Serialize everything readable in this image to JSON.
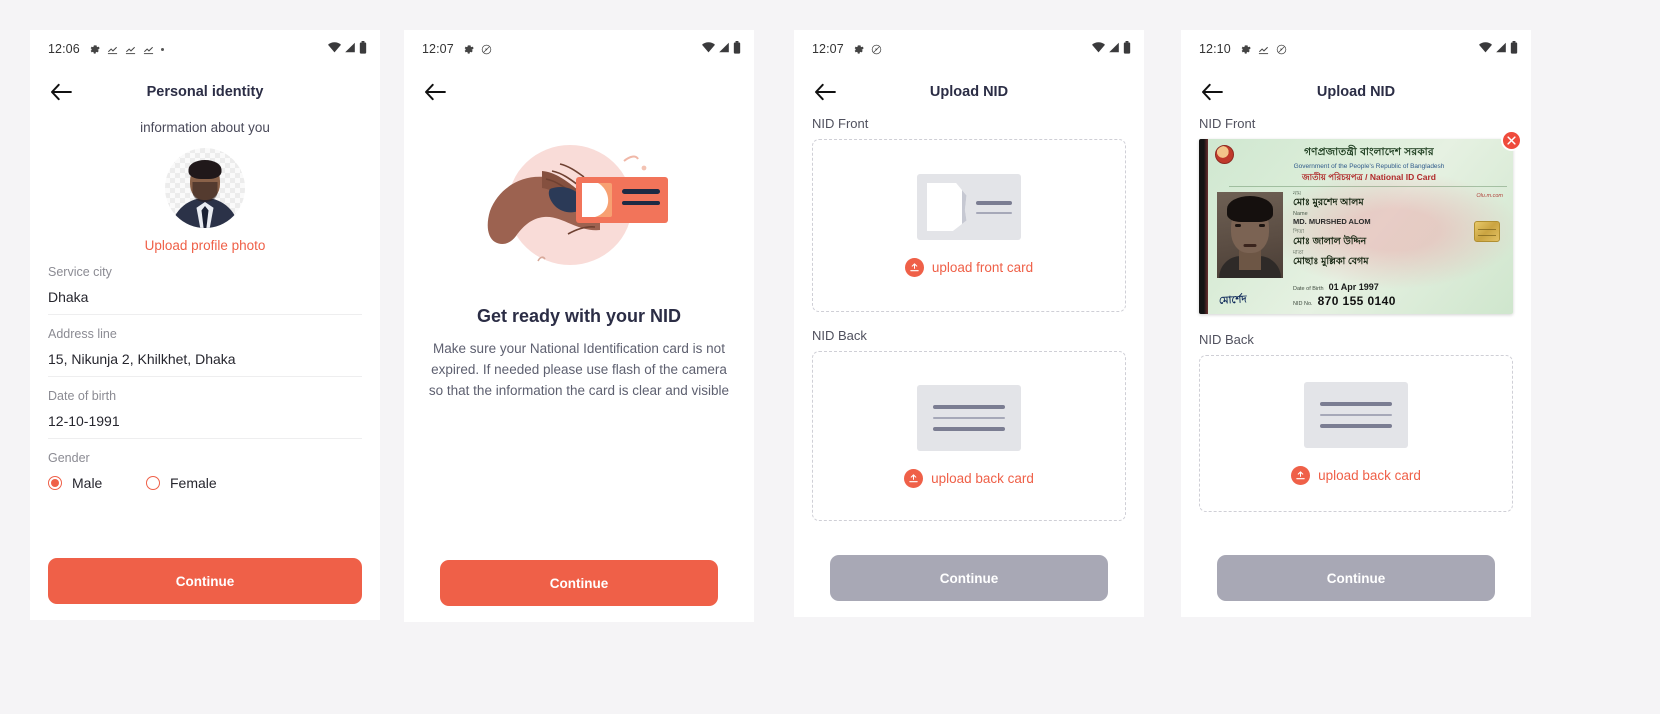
{
  "accent": "#ef6048",
  "disabled_color": "#a8a8b5",
  "title_color": "#2b2d45",
  "screens": {
    "personal_identity": {
      "status": {
        "time": "12:06"
      },
      "appbar": {
        "title": "Personal identity"
      },
      "subtitle": "information about you",
      "upload_photo_label": "Upload profile photo",
      "fields": [
        {
          "label": "Service city",
          "value": "Dhaka"
        },
        {
          "label": "Address line",
          "value": "15, Nikunja 2, Khilkhet, Dhaka"
        },
        {
          "label": "Date of birth",
          "value": "12-10-1991"
        }
      ],
      "gender": {
        "label": "Gender",
        "options": [
          {
            "label": "Male",
            "selected": true
          },
          {
            "label": "Female",
            "selected": false
          }
        ]
      },
      "continue_label": "Continue"
    },
    "get_ready": {
      "status": {
        "time": "12:07"
      },
      "title": "Get ready with your NID",
      "body": "Make sure your National Identification card is not expired. If needed please use flash of the camera so that the information the card is clear and visible",
      "continue_label": "Continue"
    },
    "upload_nid_empty": {
      "status": {
        "time": "12:07"
      },
      "appbar": {
        "title": "Upload NID"
      },
      "front": {
        "label": "NID Front",
        "upload_label": "upload front card"
      },
      "back": {
        "label": "NID Back",
        "upload_label": "upload back card"
      },
      "continue_label": "Continue"
    },
    "upload_nid_filled": {
      "status": {
        "time": "12:10"
      },
      "appbar": {
        "title": "Upload NID"
      },
      "front": {
        "label": "NID Front"
      },
      "back": {
        "label": "NID Back",
        "upload_label": "upload back card"
      },
      "continue_label": "Continue",
      "nid_card": {
        "header_bn": "গণপ্রজাতন্ত্রী বাংলাদেশ সরকার",
        "header_en": "Government of the People's Republic of Bangladesh",
        "subheader_bn": "জাতীয় পরিচয়পত্র /",
        "subheader_en": "National ID Card",
        "name_key_bn": "নাম",
        "name_bn": "মোঃ মুরশেদ আলম",
        "name_key_en": "Name",
        "name_en": "MD. MURSHED ALOM",
        "father_key_bn": "পিতা",
        "father_bn": "মোঃ জালাল উদ্দিন",
        "mother_key_bn": "মাতা",
        "mother_bn": "মোছাঃ মুল্লিকা বেগম",
        "dob_key": "Date of Birth",
        "dob_value": "01 Apr 1997",
        "nid_key": "NID No.",
        "nid_value": "870 155 0140",
        "signature": "মোর্শেদ",
        "watermark": "Olu.m.com"
      }
    }
  }
}
